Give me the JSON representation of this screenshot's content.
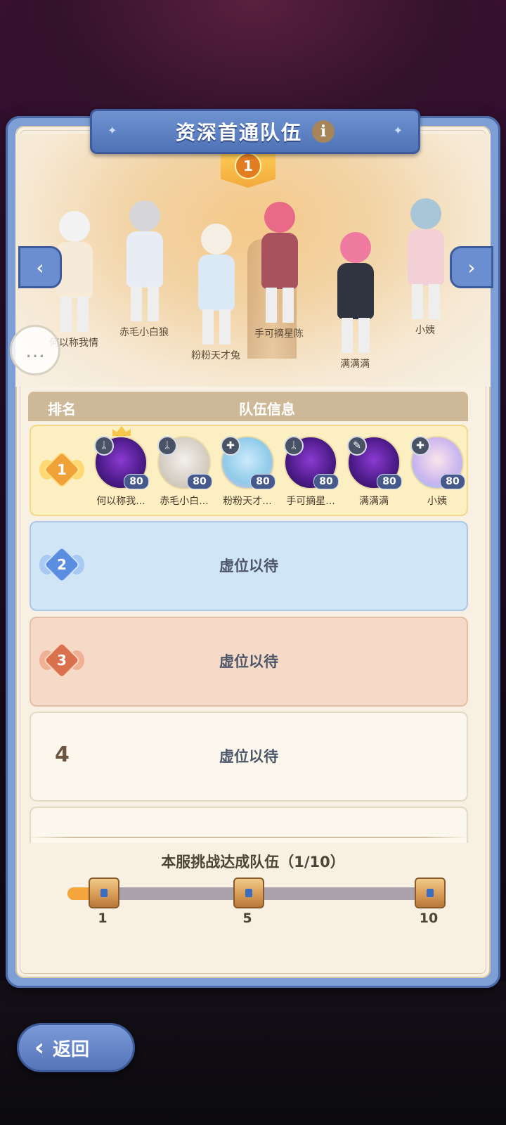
{
  "title": "资深首通队伍",
  "top_rank_banner": "1",
  "characters": [
    {
      "name": "何以称我情",
      "hair": "#f2f2f2",
      "outfit": "#f6ead8"
    },
    {
      "name": "赤毛小白狼",
      "hair": "#d6d6da",
      "outfit": "#e8ecf4"
    },
    {
      "name": "粉粉天才兔",
      "hair": "#f5efe6",
      "outfit": "#dbe8f5"
    },
    {
      "name": "手可摘星陈",
      "hair": "#e86a86",
      "outfit": "#a8525e"
    },
    {
      "name": "满满满",
      "hair": "#ef7aa0",
      "outfit": "#2f3440"
    },
    {
      "name": "小姨",
      "hair": "#a9c6d8",
      "outfit": "#f3cfd6"
    }
  ],
  "table": {
    "header_rank": "排名",
    "header_info": "队伍信息"
  },
  "ranks": [
    {
      "rank": "1",
      "members": [
        {
          "name": "何以称我...",
          "level": "80",
          "class_icon": "ᛦ",
          "portrait": "purple",
          "crown": true
        },
        {
          "name": "赤毛小白...",
          "level": "80",
          "class_icon": "ᛦ",
          "portrait": "gray",
          "crown": false
        },
        {
          "name": "粉粉天才...",
          "level": "80",
          "class_icon": "✚",
          "portrait": "blue",
          "crown": false
        },
        {
          "name": "手可摘星...",
          "level": "80",
          "class_icon": "ᛦ",
          "portrait": "purple",
          "crown": false
        },
        {
          "name": "满满满",
          "level": "80",
          "class_icon": "✎",
          "portrait": "purple",
          "crown": false
        },
        {
          "name": "小姨",
          "level": "80",
          "class_icon": "✚",
          "portrait": "pastel",
          "crown": false
        }
      ]
    },
    {
      "rank": "2",
      "placeholder": "虚位以待"
    },
    {
      "rank": "3",
      "placeholder": "虚位以待"
    },
    {
      "rank": "4",
      "placeholder": "虚位以待"
    }
  ],
  "footer": {
    "label": "本服挑战达成队伍（1/10）",
    "progress": 0.07,
    "milestones": [
      "1",
      "5",
      "10"
    ]
  },
  "back_label": "返回",
  "icons": {
    "info": "i",
    "left_arrow": "‹",
    "right_arrow": "›",
    "chat": "…"
  },
  "colors": {
    "frame": "#7d9fd6",
    "panel_bg": "#f7f0e3",
    "rank1_bg": "#fcefc1",
    "rank2_bg": "#d0e5f5",
    "rank3_bg": "#f6dac8",
    "progress": "#f2a63b"
  }
}
